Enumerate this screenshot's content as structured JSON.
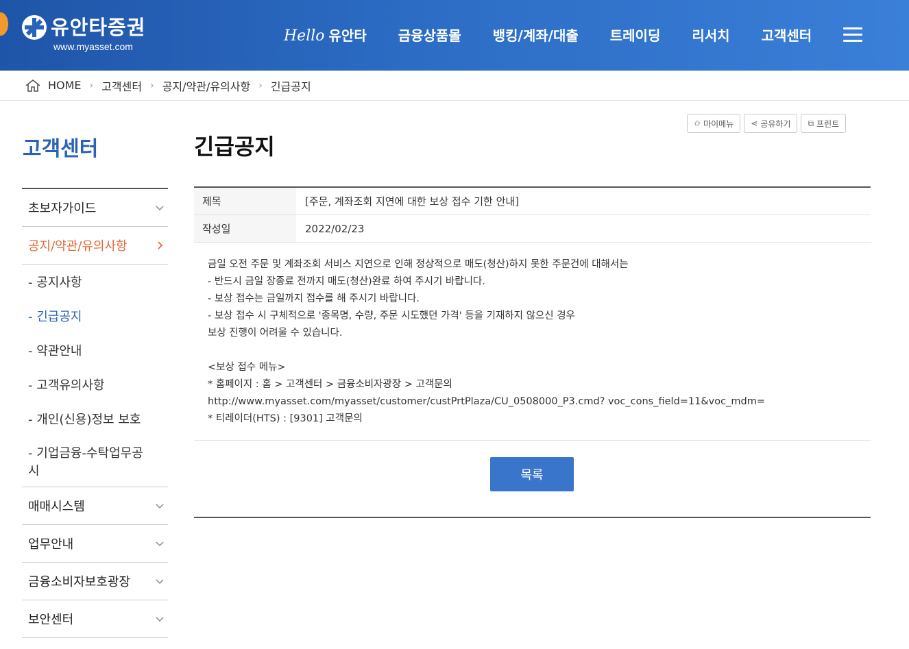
{
  "header": {
    "logo_text": "유안타증권",
    "logo_url": "www.myasset.com",
    "gnb": [
      {
        "hello": "Hello",
        "label": "유안타"
      },
      {
        "label": "금융상품몰"
      },
      {
        "label": "뱅킹/계좌/대출"
      },
      {
        "label": "트레이딩"
      },
      {
        "label": "리서치"
      },
      {
        "label": "고객센터"
      }
    ]
  },
  "breadcrumb": [
    "HOME",
    "고객센터",
    "공지/약관/유의사항",
    "긴급공지"
  ],
  "sidebar": {
    "title": "고객센터",
    "items": [
      {
        "label": "초보자가이드"
      },
      {
        "label": "공지/약관/유의사항"
      },
      {
        "label": "매매시스템"
      },
      {
        "label": "업무안내"
      },
      {
        "label": "금융소비자보호광장"
      },
      {
        "label": "보안센터"
      }
    ],
    "sub_items": [
      {
        "label": "- 공지사항"
      },
      {
        "label": "- 긴급공지"
      },
      {
        "label": "- 약관안내"
      },
      {
        "label": "- 고객유의사항"
      },
      {
        "label": "- 개인(신용)정보 보호"
      },
      {
        "label": "- 기업금융-수탁업무공시"
      }
    ]
  },
  "page": {
    "title": "긴급공지",
    "tools": [
      "마이메뉴",
      "공유하기",
      "프린트"
    ],
    "subject_label": "제목",
    "subject": "[주문, 계좌조회 지연에 대한 보상 접수 기한 안내]",
    "date_label": "작성일",
    "date": "2022/02/23",
    "body": "금일 오전 주문 및 계좌조회 서비스 지연으로 인해 정상적으로 매도(청산)하지 못한 주문건에 대해서는\n- 반드시 금일 장종료 전까지 매도(청산)완료 하여 주시기 바랍니다.\n- 보상 접수는 금일까지 접수를 해 주시기 바랍니다.\n- 보상 접수 시 구체적으로 '종목명, 수량, 주문 시도했던 가격' 등을 기재하지 않으신 경우\n보상 진행이 어려울 수 있습니다.\n\n<보상 접수 메뉴>\n* 홈페이지 : 홈 > 고객센터 > 금융소비자광장 > 고객문의\nhttp://www.myasset.com/myasset/customer/custPrtPlaza/CU_0508000_P3.cmd? voc_cons_field=11&voc_mdm=\n* 티레이더(HTS) : [9301] 고객문의",
    "list_button": "목록"
  }
}
